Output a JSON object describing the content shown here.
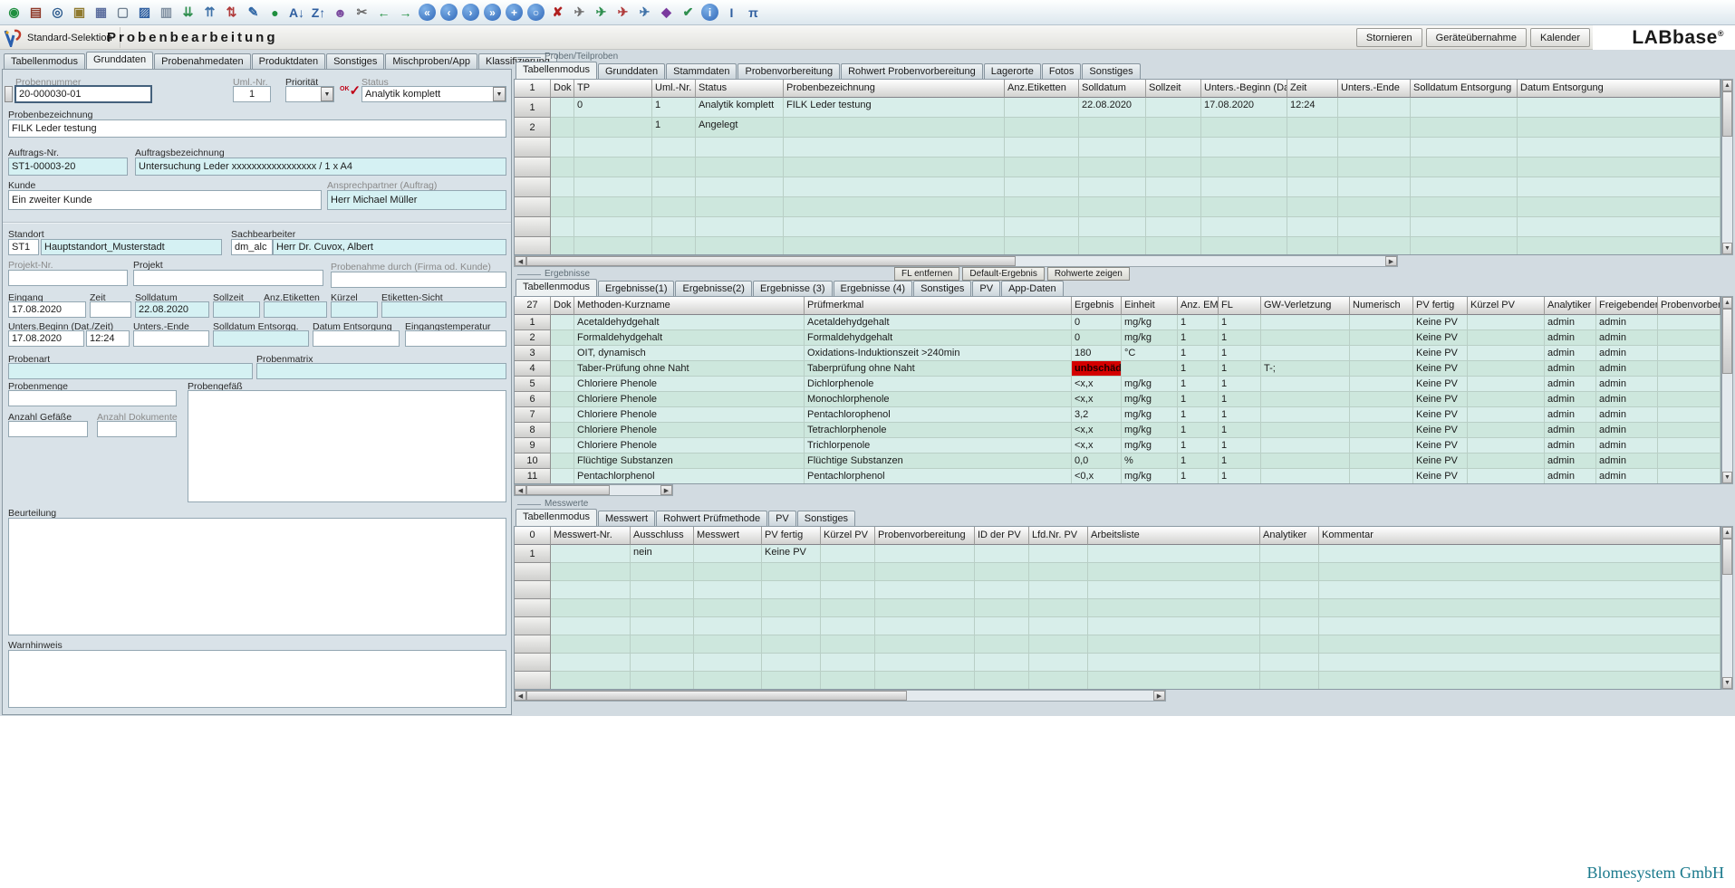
{
  "ui": {
    "dd_arrow": "▼",
    "up_arrow": "▲",
    "down_arrow": "▼",
    "left_arrow": "◀",
    "right_arrow": "▶"
  },
  "header": {
    "app_button": "Standard-Selektion",
    "title": "Probenbearbeitung",
    "buttons": [
      {
        "name": "stornieren-button",
        "label": "Stornieren"
      },
      {
        "name": "geraeteuebernahme-button",
        "label": "Geräteübernahme"
      },
      {
        "name": "kalender-button",
        "label": "Kalender"
      }
    ],
    "brand": "LABbase",
    "brand_mark": "®"
  },
  "toolbar": {
    "icons": [
      {
        "name": "refresh-icon",
        "glyph": "◉",
        "color": "#1f8f3f",
        "cls": ""
      },
      {
        "name": "printer-icon",
        "glyph": "▤",
        "color": "#8f3a2a",
        "cls": ""
      },
      {
        "name": "search-icon",
        "glyph": "◎",
        "color": "#2f5d8f",
        "cls": ""
      },
      {
        "name": "copy-icon",
        "glyph": "▣",
        "color": "#8f7a2f",
        "cls": ""
      },
      {
        "name": "storage-icon",
        "glyph": "▦",
        "color": "#5d6f9f",
        "cls": ""
      },
      {
        "name": "new-document-icon",
        "glyph": "▢",
        "color": "#6f7f8f",
        "cls": ""
      },
      {
        "name": "save-icon",
        "glyph": "▨",
        "color": "#2f5fa0",
        "cls": ""
      },
      {
        "name": "document-icon",
        "glyph": "▥",
        "color": "#7f8fa0",
        "cls": ""
      },
      {
        "name": "import-document-icon",
        "glyph": "⇊",
        "color": "#2f8f4f",
        "cls": ""
      },
      {
        "name": "export-document-icon",
        "glyph": "⇈",
        "color": "#3f72a8",
        "cls": ""
      },
      {
        "name": "sort-icon",
        "glyph": "⇅",
        "color": "#b03a3a",
        "cls": ""
      },
      {
        "name": "edit-icon",
        "glyph": "✎",
        "color": "#2f66a5",
        "cls": ""
      },
      {
        "name": "add-record-icon",
        "glyph": "●",
        "color": "#1f8f3f",
        "cls": ""
      },
      {
        "name": "sort-az-icon",
        "glyph": "A↓",
        "color": "#2f5fa0",
        "cls": ""
      },
      {
        "name": "sort-za-icon",
        "glyph": "Z↑",
        "color": "#2f5fa0",
        "cls": ""
      },
      {
        "name": "user-icon",
        "glyph": "☻",
        "color": "#7a4a9e",
        "cls": ""
      },
      {
        "name": "tools-icon",
        "glyph": "✂",
        "color": "#6a6a6a",
        "cls": ""
      },
      {
        "name": "undo-icon",
        "glyph": "←",
        "color": "#1f8f3f",
        "cls": ""
      },
      {
        "name": "redo-icon",
        "glyph": "→",
        "color": "#1f8f3f",
        "cls": ""
      },
      {
        "name": "first-record-icon",
        "glyph": "«",
        "color": "#ffffff",
        "cls": "circ"
      },
      {
        "name": "prev-record-icon",
        "glyph": "‹",
        "color": "#ffffff",
        "cls": "circ"
      },
      {
        "name": "next-record-icon",
        "glyph": "›",
        "color": "#ffffff",
        "cls": "circ"
      },
      {
        "name": "last-record-icon",
        "glyph": "»",
        "color": "#ffffff",
        "cls": "circ"
      },
      {
        "name": "new-record-icon",
        "glyph": "+",
        "color": "#ffffff",
        "cls": "circ"
      },
      {
        "name": "reload-record-icon",
        "glyph": "○",
        "color": "#ffffff",
        "cls": "circ"
      },
      {
        "name": "delete-document-icon",
        "glyph": "✘",
        "color": "#b02020",
        "cls": ""
      },
      {
        "name": "send-icon",
        "glyph": "✈",
        "color": "#707070",
        "cls": ""
      },
      {
        "name": "send-ok-icon",
        "glyph": "✈",
        "color": "#2f8f4f",
        "cls": ""
      },
      {
        "name": "send-alert-icon",
        "glyph": "✈",
        "color": "#b03a3a",
        "cls": ""
      },
      {
        "name": "send-info-icon",
        "glyph": "✈",
        "color": "#3f72a8",
        "cls": ""
      },
      {
        "name": "package-icon",
        "glyph": "◆",
        "color": "#7a3a9e",
        "cls": ""
      },
      {
        "name": "approve-document-icon",
        "glyph": "✔",
        "color": "#2f8f4f",
        "cls": ""
      },
      {
        "name": "info-icon",
        "glyph": "i",
        "color": "#ffffff",
        "cls": "circ"
      },
      {
        "name": "field-info-icon",
        "glyph": "I",
        "color": "#2f5fa0",
        "cls": ""
      },
      {
        "name": "formula-icon",
        "glyph": "π",
        "color": "#2f5fa0",
        "cls": ""
      }
    ]
  },
  "sample": {
    "tabs": [
      {
        "name": "tab-tabellenmodus",
        "label": "Tabellenmodus",
        "state": ""
      },
      {
        "name": "tab-grunddaten",
        "label": "Grunddaten",
        "state": "active"
      },
      {
        "name": "tab-probenahmedaten",
        "label": "Probenahmedaten",
        "state": ""
      },
      {
        "name": "tab-produktdaten",
        "label": "Produktdaten",
        "state": ""
      },
      {
        "name": "tab-sonstiges",
        "label": "Sonstiges",
        "state": ""
      },
      {
        "name": "tab-mischproben-app",
        "label": "Mischproben/App",
        "state": ""
      },
      {
        "name": "tab-klassifizierung",
        "label": "Klassifizierung",
        "state": ""
      }
    ],
    "fields": {
      "probennummer": {
        "label": "Probennummer",
        "value": "20-000030-01"
      },
      "uml_nr": {
        "label": "Uml.-Nr.",
        "value": "1"
      },
      "prioritaet": {
        "label": "Priorität",
        "value": ""
      },
      "ok_icon": {
        "label": "OK",
        "glyph": "✓"
      },
      "status": {
        "label": "Status",
        "value": "Analytik komplett"
      },
      "probenbezeichnung": {
        "label": "Probenbezeichnung",
        "value": "FILK Leder testung"
      },
      "auftrags_nr": {
        "label": "Auftrags-Nr.",
        "value": "ST1-00003-20"
      },
      "auftragsbezeichnung": {
        "label": "Auftragsbezeichnung",
        "value": "Untersuchung Leder xxxxxxxxxxxxxxxxx /  1 x A4"
      },
      "kunde": {
        "label": "Kunde",
        "value": "Ein zweiter Kunde"
      },
      "ansprechpartner": {
        "label": "Ansprechpartner (Auftrag)",
        "value": "Herr Michael Müller"
      },
      "standort": {
        "label": "Standort",
        "code": "ST1",
        "value": "Hauptstandort_Musterstadt"
      },
      "sachbearbeiter": {
        "label": "Sachbearbeiter",
        "code": "dm_alc",
        "value": "Herr Dr. Cuvox, Albert"
      },
      "projekt_nr": {
        "label": "Projekt-Nr.",
        "value": ""
      },
      "projekt": {
        "label": "Projekt",
        "value": ""
      },
      "probenahme_durch": {
        "label": "Probenahme durch (Firma od. Kunde)",
        "value": ""
      },
      "eingang": {
        "label": "Eingang",
        "value": "17.08.2020"
      },
      "zeit": {
        "label": "Zeit",
        "value": ""
      },
      "solldatum": {
        "label": "Solldatum",
        "value": "22.08.2020"
      },
      "sollzeit": {
        "label": "Sollzeit",
        "value": ""
      },
      "anz_etiketten": {
        "label": "Anz.Etiketten",
        "value": ""
      },
      "kuerzel": {
        "label": "Kürzel",
        "value": ""
      },
      "etiketten_sicht": {
        "label": "Etiketten-Sicht",
        "value": ""
      },
      "unters_beginn": {
        "label": "Unters.Beginn (Dat./Zeit)",
        "date": "17.08.2020",
        "time": "12:24"
      },
      "unters_ende": {
        "label": "Unters.-Ende",
        "value": ""
      },
      "solldatum_entsorgg": {
        "label": "Solldatum Entsorgg.",
        "value": ""
      },
      "datum_entsorgung": {
        "label": "Datum Entsorgung",
        "value": ""
      },
      "eingangstemperatur": {
        "label": "Eingangstemperatur",
        "value": ""
      },
      "probenart": {
        "label": "Probenart",
        "value": ""
      },
      "probenmatrix": {
        "label": "Probenmatrix",
        "value": ""
      },
      "probenmenge": {
        "label": "Probenmenge",
        "value": ""
      },
      "probengefaess": {
        "label": "Probengefäß",
        "value": ""
      },
      "anzahl_gefaesse": {
        "label": "Anzahl Gefäße",
        "value": ""
      },
      "anzahl_dokumente": {
        "label": "Anzahl Dokumente",
        "value": ""
      },
      "beurteilung": {
        "label": "Beurteilung",
        "value": ""
      },
      "warnhinweis": {
        "label": "Warnhinweis",
        "value": ""
      }
    }
  },
  "proben": {
    "group_label": "Proben/Teilproben",
    "count": "1",
    "tabs": [
      {
        "name": "tab-proben-tabellenmodus",
        "label": "Tabellenmodus",
        "state": "active"
      },
      {
        "name": "tab-proben-grunddaten",
        "label": "Grunddaten",
        "state": ""
      },
      {
        "name": "tab-proben-stammdaten",
        "label": "Stammdaten",
        "state": ""
      },
      {
        "name": "tab-proben-probenvorbereitung",
        "label": "Probenvorbereitung",
        "state": ""
      },
      {
        "name": "tab-proben-rohwert-probenvorbereitung",
        "label": "Rohwert Probenvorbereitung",
        "state": ""
      },
      {
        "name": "tab-proben-lagerorte",
        "label": "Lagerorte",
        "state": ""
      },
      {
        "name": "tab-proben-fotos",
        "label": "Fotos",
        "state": ""
      },
      {
        "name": "tab-proben-sonstiges",
        "label": "Sonstiges",
        "state": ""
      }
    ],
    "columns": [
      "Dok",
      "TP",
      "Uml.-Nr.",
      "Status",
      "Probenbezeichnung",
      "Anz.Etiketten",
      "Solldatum",
      "Sollzeit",
      "Unters.-Beginn (Dat./Zeit)",
      "Zeit",
      "Unters.-Ende",
      "Solldatum Entsorgung",
      "Datum Entsorgung"
    ],
    "rows": [
      {
        "nr": "1",
        "dok": "",
        "tp": "0",
        "uml": "1",
        "status": "Analytik komplett",
        "bez": "FILK Leder testung",
        "anz": "",
        "solldatum": "22.08.2020",
        "sollzeit": "",
        "ub": "17.08.2020",
        "zeit": "12:24",
        "ue": "",
        "sde": "",
        "de": ""
      },
      {
        "nr": "2",
        "dok": "",
        "tp": "",
        "uml": "1",
        "status": "Angelegt",
        "bez": "",
        "anz": "",
        "solldatum": "",
        "sollzeit": "",
        "ub": "",
        "zeit": "",
        "ue": "",
        "sde": "",
        "de": ""
      }
    ]
  },
  "ergebnisse": {
    "group_label": "Ergebnisse",
    "count": "27",
    "actions": [
      {
        "name": "fl-entfernen-button",
        "label": "FL entfernen"
      },
      {
        "name": "default-ergebnis-button",
        "label": "Default-Ergebnis"
      },
      {
        "name": "rohwerte-zeigen-button",
        "label": "Rohwerte zeigen"
      }
    ],
    "tabs": [
      {
        "name": "tab-erg-tabellenmodus",
        "label": "Tabellenmodus",
        "state": "active"
      },
      {
        "name": "tab-erg-1",
        "label": "Ergebnisse(1)",
        "state": ""
      },
      {
        "name": "tab-erg-2",
        "label": "Ergebnisse(2)",
        "state": ""
      },
      {
        "name": "tab-erg-3",
        "label": "Ergebnisse (3)",
        "state": ""
      },
      {
        "name": "tab-erg-4",
        "label": "Ergebnisse (4)",
        "state": ""
      },
      {
        "name": "tab-erg-sonstiges",
        "label": "Sonstiges",
        "state": ""
      },
      {
        "name": "tab-erg-pv",
        "label": "PV",
        "state": ""
      },
      {
        "name": "tab-erg-app-daten",
        "label": "App-Daten",
        "state": ""
      }
    ],
    "columns": [
      "Dok",
      "Methoden-Kurzname",
      "Prüfmerkmal",
      "Ergebnis",
      "Einheit",
      "Anz. EM",
      "FL",
      "GW-Verletzung",
      "Numerisch",
      "PV fertig",
      "Kürzel PV",
      "Analytiker",
      "Freigebender",
      "Probenvorbereitung"
    ],
    "rows": [
      {
        "nr": "1",
        "methode": "Acetaldehydgehalt",
        "merkmal": "Acetaldehydgehalt",
        "ergebnis": "0",
        "cls": "",
        "einheit": "mg/kg",
        "anz_em": "1",
        "fl": "1",
        "gw": "",
        "numerisch": "",
        "pv_fertig": "Keine PV",
        "kuerzel_pv": "",
        "analytiker": "admin",
        "freigebender": "admin",
        "probenvorbereitung": ""
      },
      {
        "nr": "2",
        "methode": "Formaldehydgehalt",
        "merkmal": "Formaldehydgehalt",
        "ergebnis": "0",
        "cls": "",
        "einheit": "mg/kg",
        "anz_em": "1",
        "fl": "1",
        "gw": "",
        "numerisch": "",
        "pv_fertig": "Keine PV",
        "kuerzel_pv": "",
        "analytiker": "admin",
        "freigebender": "admin",
        "probenvorbereitung": ""
      },
      {
        "nr": "3",
        "methode": "OIT, dynamisch",
        "merkmal": "Oxidations-Induktionszeit >240min",
        "ergebnis": "180",
        "cls": "",
        "einheit": "°C",
        "anz_em": "1",
        "fl": "1",
        "gw": "",
        "numerisch": "",
        "pv_fertig": "Keine PV",
        "kuerzel_pv": "",
        "analytiker": "admin",
        "freigebender": "admin",
        "probenvorbereitung": ""
      },
      {
        "nr": "4",
        "methode": "Taber-Prüfung ohne Naht",
        "merkmal": "Taberprüfung ohne Naht",
        "ergebnis": "unbschäd",
        "cls": "alert",
        "einheit": "",
        "anz_em": "1",
        "fl": "1",
        "gw": "T-;",
        "numerisch": "",
        "pv_fertig": "Keine PV",
        "kuerzel_pv": "",
        "analytiker": "admin",
        "freigebender": "admin",
        "probenvorbereitung": ""
      },
      {
        "nr": "5",
        "methode": "Chloriere Phenole",
        "merkmal": "Dichlorphenole",
        "ergebnis": "<x,x",
        "cls": "",
        "einheit": "mg/kg",
        "anz_em": "1",
        "fl": "1",
        "gw": "",
        "numerisch": "",
        "pv_fertig": "Keine PV",
        "kuerzel_pv": "",
        "analytiker": "admin",
        "freigebender": "admin",
        "probenvorbereitung": ""
      },
      {
        "nr": "6",
        "methode": "Chloriere Phenole",
        "merkmal": "Monochlorphenole",
        "ergebnis": "<x,x",
        "cls": "",
        "einheit": "mg/kg",
        "anz_em": "1",
        "fl": "1",
        "gw": "",
        "numerisch": "",
        "pv_fertig": "Keine PV",
        "kuerzel_pv": "",
        "analytiker": "admin",
        "freigebender": "admin",
        "probenvorbereitung": ""
      },
      {
        "nr": "7",
        "methode": "Chloriere Phenole",
        "merkmal": "Pentachlorophenol",
        "ergebnis": "3,2",
        "cls": "",
        "einheit": "mg/kg",
        "anz_em": "1",
        "fl": "1",
        "gw": "",
        "numerisch": "",
        "pv_fertig": "Keine PV",
        "kuerzel_pv": "",
        "analytiker": "admin",
        "freigebender": "admin",
        "probenvorbereitung": ""
      },
      {
        "nr": "8",
        "methode": "Chloriere Phenole",
        "merkmal": "Tetrachlorphenole",
        "ergebnis": "<x,x",
        "cls": "",
        "einheit": "mg/kg",
        "anz_em": "1",
        "fl": "1",
        "gw": "",
        "numerisch": "",
        "pv_fertig": "Keine PV",
        "kuerzel_pv": "",
        "analytiker": "admin",
        "freigebender": "admin",
        "probenvorbereitung": ""
      },
      {
        "nr": "9",
        "methode": "Chloriere Phenole",
        "merkmal": "Trichlorpenole",
        "ergebnis": "<x,x",
        "cls": "",
        "einheit": "mg/kg",
        "anz_em": "1",
        "fl": "1",
        "gw": "",
        "numerisch": "",
        "pv_fertig": "Keine PV",
        "kuerzel_pv": "",
        "analytiker": "admin",
        "freigebender": "admin",
        "probenvorbereitung": ""
      },
      {
        "nr": "10",
        "methode": "Flüchtige Substanzen",
        "merkmal": "Flüchtige Substanzen",
        "ergebnis": "0,0",
        "cls": "",
        "einheit": "%",
        "anz_em": "1",
        "fl": "1",
        "gw": "",
        "numerisch": "",
        "pv_fertig": "Keine PV",
        "kuerzel_pv": "",
        "analytiker": "admin",
        "freigebender": "admin",
        "probenvorbereitung": ""
      },
      {
        "nr": "11",
        "methode": "Pentachlorphenol",
        "merkmal": "Pentachlorphenol",
        "ergebnis": "<0,x",
        "cls": "",
        "einheit": "mg/kg",
        "anz_em": "1",
        "fl": "1",
        "gw": "",
        "numerisch": "",
        "pv_fertig": "Keine PV",
        "kuerzel_pv": "",
        "analytiker": "admin",
        "freigebender": "admin",
        "probenvorbereitung": ""
      }
    ]
  },
  "messwerte": {
    "group_label": "Messwerte",
    "count": "0",
    "tabs": [
      {
        "name": "tab-mess-tabellenmodus",
        "label": "Tabellenmodus",
        "state": "active"
      },
      {
        "name": "tab-mess-messwert",
        "label": "Messwert",
        "state": ""
      },
      {
        "name": "tab-mess-rohwert-pruefmethode",
        "label": "Rohwert Prüfmethode",
        "state": ""
      },
      {
        "name": "tab-mess-pv",
        "label": "PV",
        "state": ""
      },
      {
        "name": "tab-mess-sonstiges",
        "label": "Sonstiges",
        "state": ""
      }
    ],
    "columns": [
      "Messwert-Nr.",
      "Ausschluss",
      "Messwert",
      "PV fertig",
      "Kürzel PV",
      "Probenvorbereitung",
      "ID der PV",
      "Lfd.Nr. PV",
      "Arbeitsliste",
      "Analytiker",
      "Kommentar"
    ],
    "rows": [
      {
        "nr": "1",
        "messwert_nr": "",
        "ausschluss": "nein",
        "messwert": "",
        "pv_fertig": "Keine PV",
        "kuerzel_pv": "",
        "probenvorbereitung": "",
        "id_pv": "",
        "lfd_pv": "",
        "arbeitsliste": "",
        "analytiker": "",
        "kommentar": ""
      }
    ]
  },
  "footer": {
    "company": "Blomesystem GmbH"
  }
}
